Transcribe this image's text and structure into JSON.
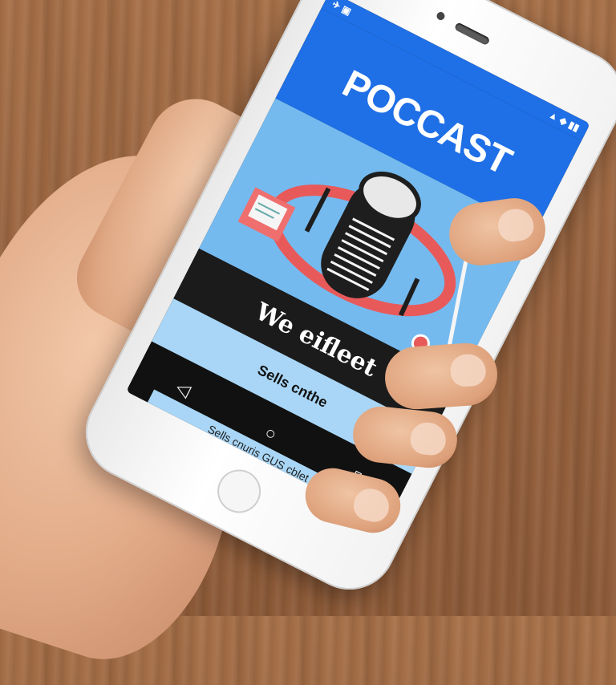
{
  "screen": {
    "status_left": "✈ ▣",
    "status_right": "▲ ◆ ▮▮",
    "title": "POCCAST",
    "caption": "We eifleet",
    "subcaption": "Sells cnthe",
    "footer_text": "Sells cnuris GUS cblet",
    "nav": {
      "back_icon": "◁",
      "home_icon": "○",
      "recents_icon": "▯"
    }
  },
  "colors": {
    "header_blue": "#1f6fe6",
    "hero_blue": "#6cb4ee",
    "accent_red": "#e85a5a",
    "phone_white": "#f5f5f5",
    "wood": "#9a6541"
  }
}
